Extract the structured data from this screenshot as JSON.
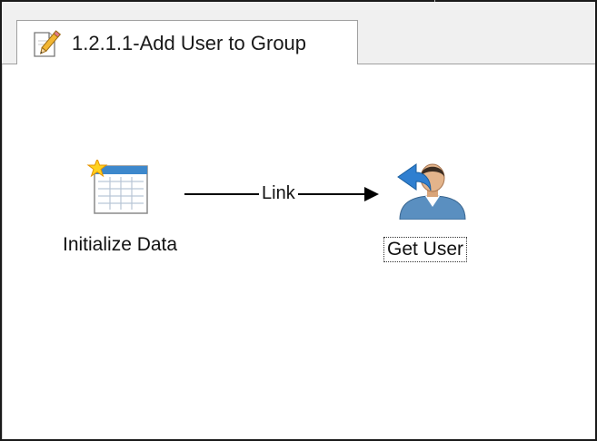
{
  "tab": {
    "title": "1.2.1.1-Add User to Group",
    "icon": "edit-document-icon"
  },
  "workflow": {
    "nodes": [
      {
        "id": "initialize-data",
        "label": "Initialize Data",
        "icon": "new-table-data-icon",
        "selected": false
      },
      {
        "id": "get-user",
        "label": "Get User",
        "icon": "get-user-icon",
        "selected": true
      }
    ],
    "link": {
      "label": "Link",
      "from": "Initialize Data",
      "to": "Get User"
    }
  },
  "colors": {
    "window_border": "#1a1a1a",
    "tab_strip": "#f0f0f0",
    "canvas": "#ffffff",
    "user_shirt": "#5a8fc0",
    "arrow_blue": "#2f7fd0"
  }
}
